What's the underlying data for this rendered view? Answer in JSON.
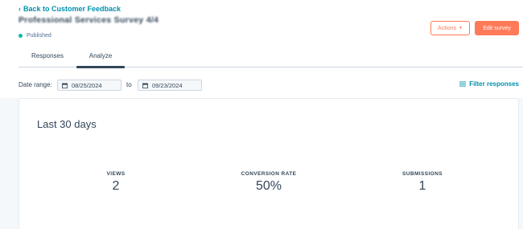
{
  "header": {
    "back_chevron": "‹",
    "back_label": "Back to Customer Feedback",
    "survey_title": "Professional Services Survey 4/4",
    "status_label": "Published",
    "status_color": "#00bda5"
  },
  "actions": {
    "actions_label": "Actions",
    "actions_caret": "▼",
    "edit_label": "Edit survey",
    "accent_color": "#ff7a59"
  },
  "tabs": [
    {
      "label": "Responses",
      "active": false
    },
    {
      "label": "Analyze",
      "active": true
    }
  ],
  "filters": {
    "date_range_label": "Date range:",
    "start_date": "08/25/2024",
    "to_label": "to",
    "end_date": "09/23/2024",
    "filter_label": "Filter responses",
    "calendar_icon": "calendar-icon",
    "filter_icon": "filter-lines-icon"
  },
  "summary": {
    "title": "Last 30 days",
    "metrics": [
      {
        "label": "VIEWS",
        "value": "2"
      },
      {
        "label": "CONVERSION RATE",
        "value": "50%"
      },
      {
        "label": "SUBMISSIONS",
        "value": "1"
      }
    ]
  }
}
